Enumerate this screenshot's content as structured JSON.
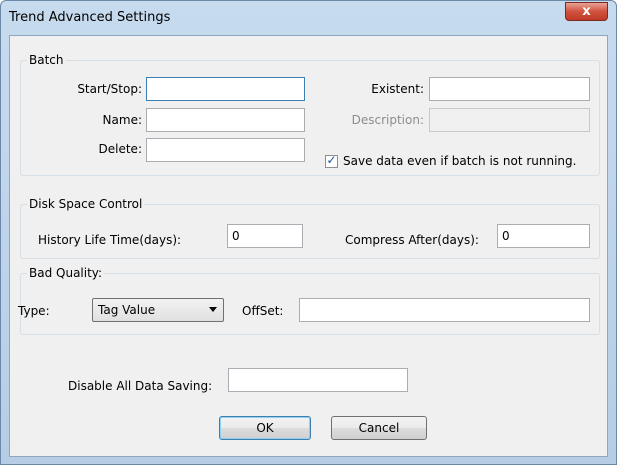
{
  "window": {
    "title": "Trend Advanced Settings",
    "close_glyph": "x"
  },
  "batch": {
    "legend": "Batch",
    "start_stop_label": "Start/Stop:",
    "start_stop_value": "",
    "name_label": "Name:",
    "name_value": "",
    "delete_label": "Delete:",
    "delete_value": "",
    "existent_label": "Existent:",
    "existent_value": "",
    "description_label": "Description:",
    "description_value": "",
    "save_data_checked": true,
    "save_data_label": "Save data even if batch is not running."
  },
  "disk": {
    "legend": "Disk Space Control",
    "history_label": "History Life Time(days):",
    "history_value": "0",
    "compress_label": "Compress After(days):",
    "compress_value": "0"
  },
  "bad_quality": {
    "legend": "Bad Quality:",
    "type_label": "Type:",
    "type_value": "Tag Value",
    "offset_label": "OffSet:",
    "offset_value": ""
  },
  "disable": {
    "label": "Disable All Data Saving:",
    "value": ""
  },
  "buttons": {
    "ok": "OK",
    "cancel": "Cancel"
  },
  "icons": {
    "checkmark": "checkmark-icon",
    "close": "close-icon",
    "dropdown": "chevron-down-icon"
  }
}
